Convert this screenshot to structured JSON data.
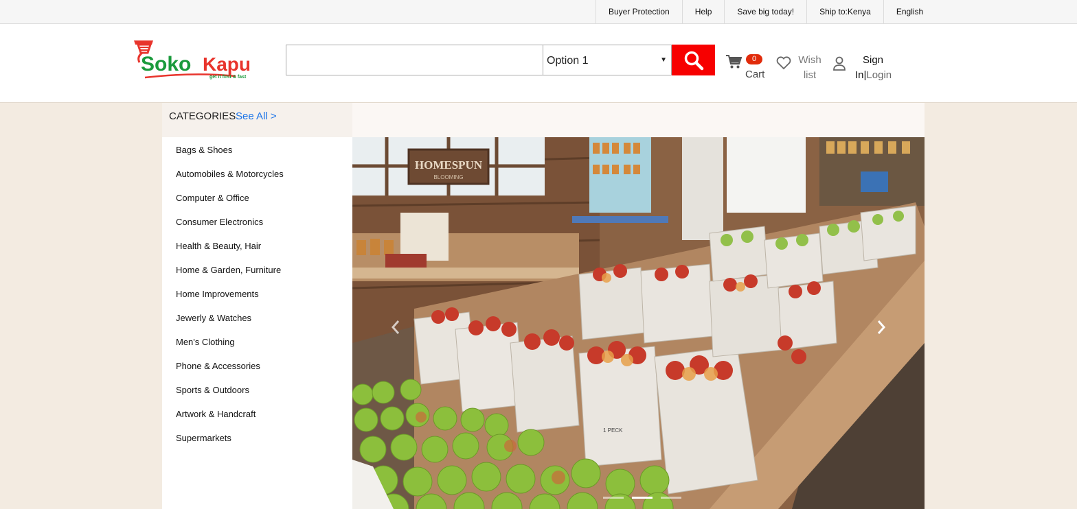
{
  "topbar": {
    "links": [
      "Buyer Protection",
      "Help",
      "Save big today!",
      "Ship to:Kenya",
      "English"
    ]
  },
  "logo": {
    "name_part1": "Soko",
    "name_part2": "Kapu",
    "tagline": "get it first & fast"
  },
  "search": {
    "query": "",
    "category_selected": "Option 1"
  },
  "cart": {
    "count": "0",
    "label": "Cart"
  },
  "wishlist": {
    "label_line1": "Wish",
    "label_line2": "list"
  },
  "account": {
    "sign_line1": "Sign",
    "sign_line2": "In",
    "separator": "|",
    "login": "Login"
  },
  "categories": {
    "title": "CATEGORIES",
    "see_all": "See All >",
    "items": [
      "Bags & Shoes",
      "Automobiles & Motorcycles",
      "Computer & Office",
      "Consumer Electronics",
      "Health & Beauty, Hair",
      "Home & Garden, Furniture",
      "Home Improvements",
      "Jewerly & Watches",
      "Men's Clothing",
      "Phone & Accessories",
      "Sports & Outdoors",
      "Artwork & Handcraft",
      "Supermarkets"
    ]
  },
  "banner": {
    "sign_line1": "HOMESPUN",
    "sign_line2": "BLOOMING",
    "bag_label": "1 PECK",
    "slide_count": 3,
    "active_slide": 2
  },
  "colors": {
    "brand_green": "#1a9a3c",
    "brand_red": "#e8342c",
    "search_button": "#f70000",
    "badge": "#e12b0b",
    "link_blue": "#1a73e8",
    "page_bg": "#f3ebe1"
  }
}
